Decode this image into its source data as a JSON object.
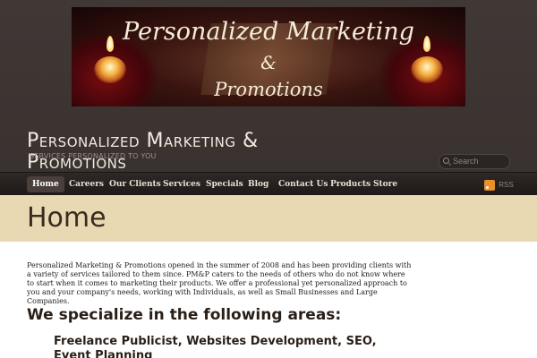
{
  "banner": {
    "line1": "Personalized Marketing",
    "line2": "&",
    "line3": "Promotions"
  },
  "site": {
    "title": "Personalized Marketing & Promotions",
    "tagline": "Services Personalized to You"
  },
  "search": {
    "placeholder": "Search"
  },
  "nav": {
    "items": [
      {
        "label": "Home",
        "active": true
      },
      {
        "label": "Careers"
      },
      {
        "label": "Our Clients"
      },
      {
        "label": "Services"
      },
      {
        "label": "Specials"
      },
      {
        "label": "Blog"
      },
      {
        "label": "Contact Us"
      },
      {
        "label": "Products"
      },
      {
        "label": "Store"
      }
    ]
  },
  "rss": {
    "label": "RSS",
    "icon": "rss-icon"
  },
  "page": {
    "title": "Home",
    "intro": "Personalized Marketing & Promotions opened in the summer of 2008 and has been providing clients with a variety of services tailored to them since. PM&P caters to the needs of others who do not know where to start when it comes to marketing their products. We offer a professional yet personalized approach to you and your company's needs, working with Individuals, as well as Small Businesses and Large Companies.",
    "heading": "We specialize in the following areas:",
    "subheading": "Freelance Publicist, Websites Development, SEO, Event Planning"
  },
  "colors": {
    "header_bg": "#3a3330",
    "nav_bg": "#1f1a18",
    "page_head_bg": "#e8d9b3",
    "rss_orange": "#e8902a"
  }
}
